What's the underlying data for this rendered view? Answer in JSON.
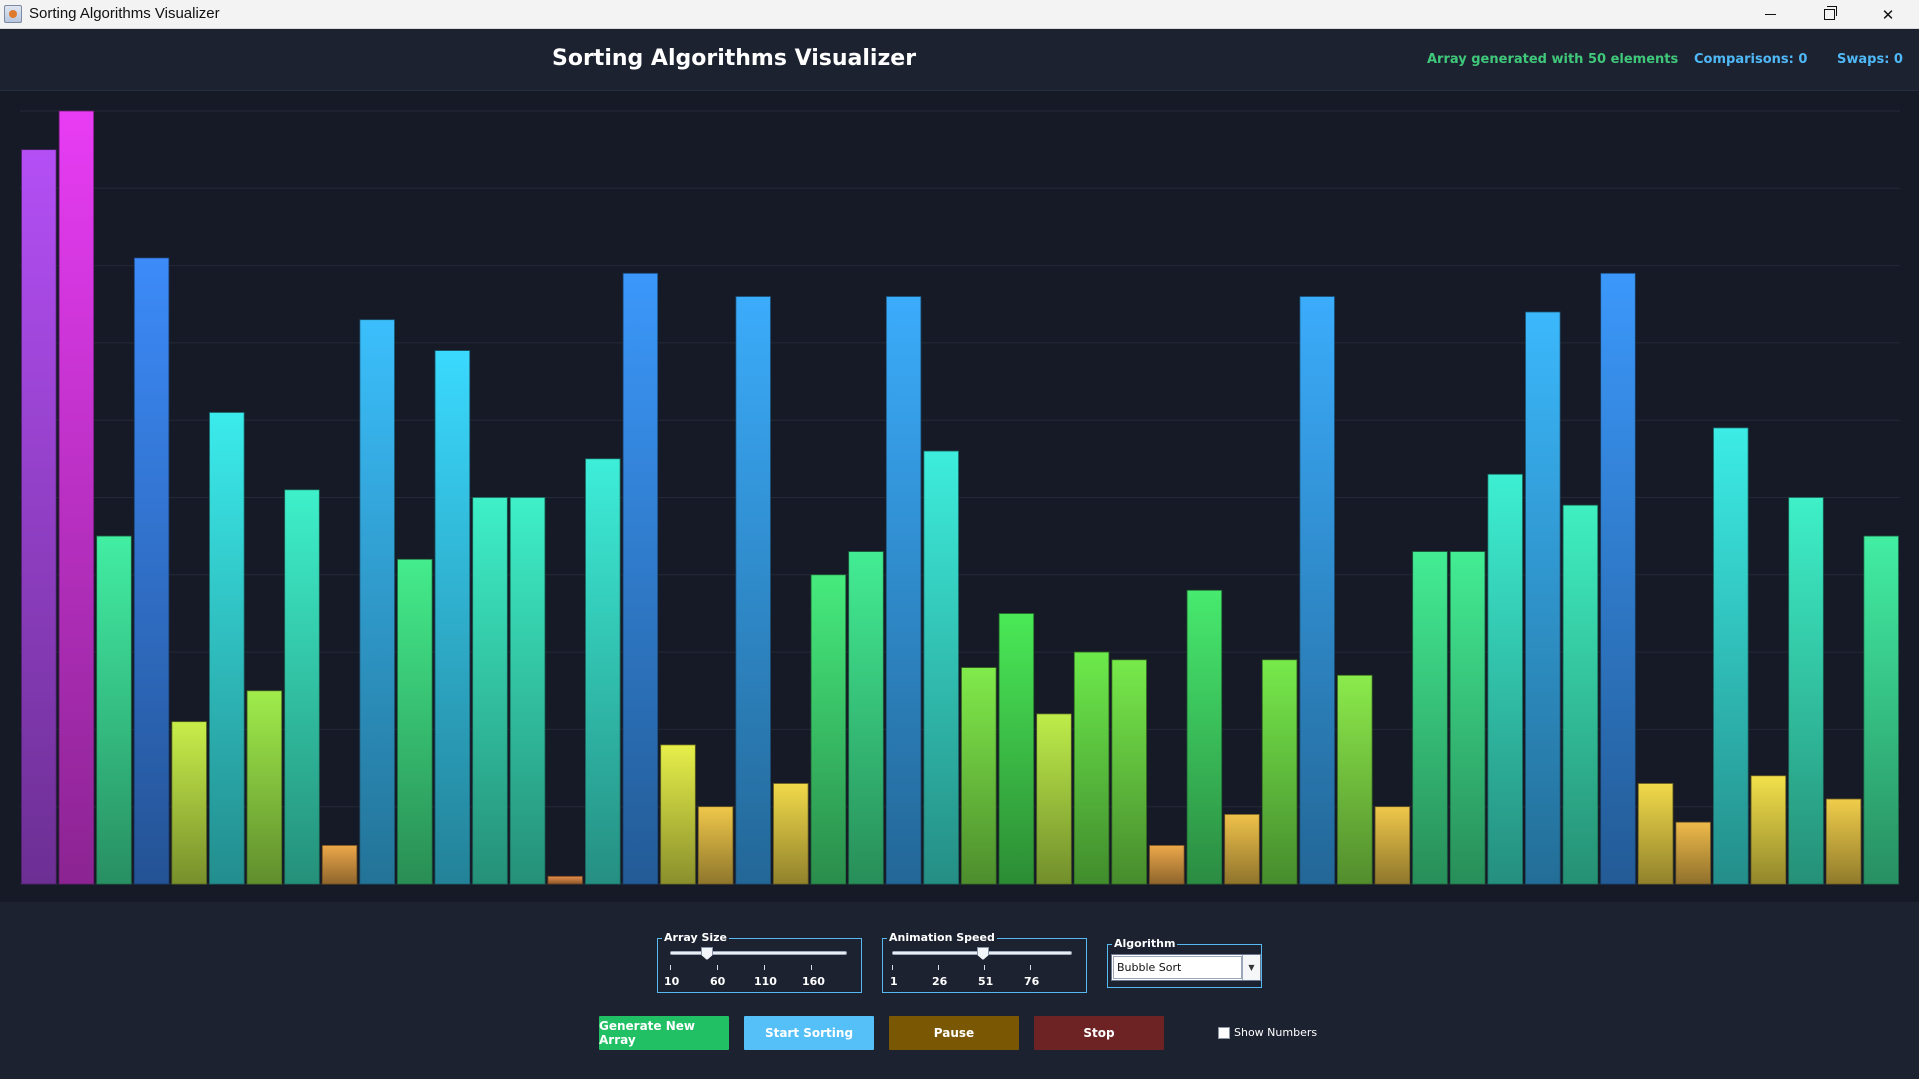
{
  "window": {
    "title": "Sorting Algorithms Visualizer",
    "minimize_glyph": "minimize-icon",
    "maximize_glyph": "restore-icon",
    "close_glyph": "✕"
  },
  "header": {
    "title": "Sorting Algorithms Visualizer",
    "status_message": "Array generated with 50 elements",
    "comparisons": "Comparisons: 0",
    "swaps": "Swaps: 0",
    "colors": {
      "status_message": "#3fc87a",
      "counters": "#4fb8f6"
    }
  },
  "controls": {
    "array_size": {
      "label": "Array Size",
      "ticks": [
        "10",
        "60",
        "110",
        "160"
      ],
      "value": 50
    },
    "animation_speed": {
      "label": "Animation Speed",
      "ticks": [
        "1",
        "26",
        "51",
        "76"
      ],
      "value": 51
    },
    "algorithm": {
      "label": "Algorithm",
      "selected": "Bubble Sort"
    },
    "buttons": {
      "generate": "Generate New Array",
      "start": "Start Sorting",
      "pause": "Pause",
      "stop": "Stop"
    },
    "show_numbers": {
      "label": "Show Numbers",
      "checked": false
    },
    "colors": {
      "generate": "#22c065",
      "start": "#55bff7",
      "pause": "#7a5703",
      "stop": "#6d2323",
      "group_border": "#58b8f2"
    }
  },
  "chart_data": {
    "type": "bar",
    "categories": [],
    "values": [
      95,
      100,
      45,
      81,
      21,
      61,
      25,
      51,
      5,
      73,
      42,
      69,
      50,
      50,
      1,
      55,
      79,
      18,
      10,
      76,
      13,
      40,
      43,
      76,
      56,
      28,
      35,
      22,
      30,
      29,
      5,
      38,
      9,
      29,
      76,
      27,
      10,
      43,
      43,
      53,
      74,
      49,
      79,
      13,
      8,
      59,
      14,
      50,
      11,
      45
    ],
    "ylim": [
      0,
      100
    ],
    "grid": true,
    "color_by_value": [
      "#e8894a",
      "#f4f04a",
      "#4be84b",
      "#3ef0c8",
      "#3ae8ff",
      "#3c7cf8",
      "#e83cf4"
    ]
  }
}
